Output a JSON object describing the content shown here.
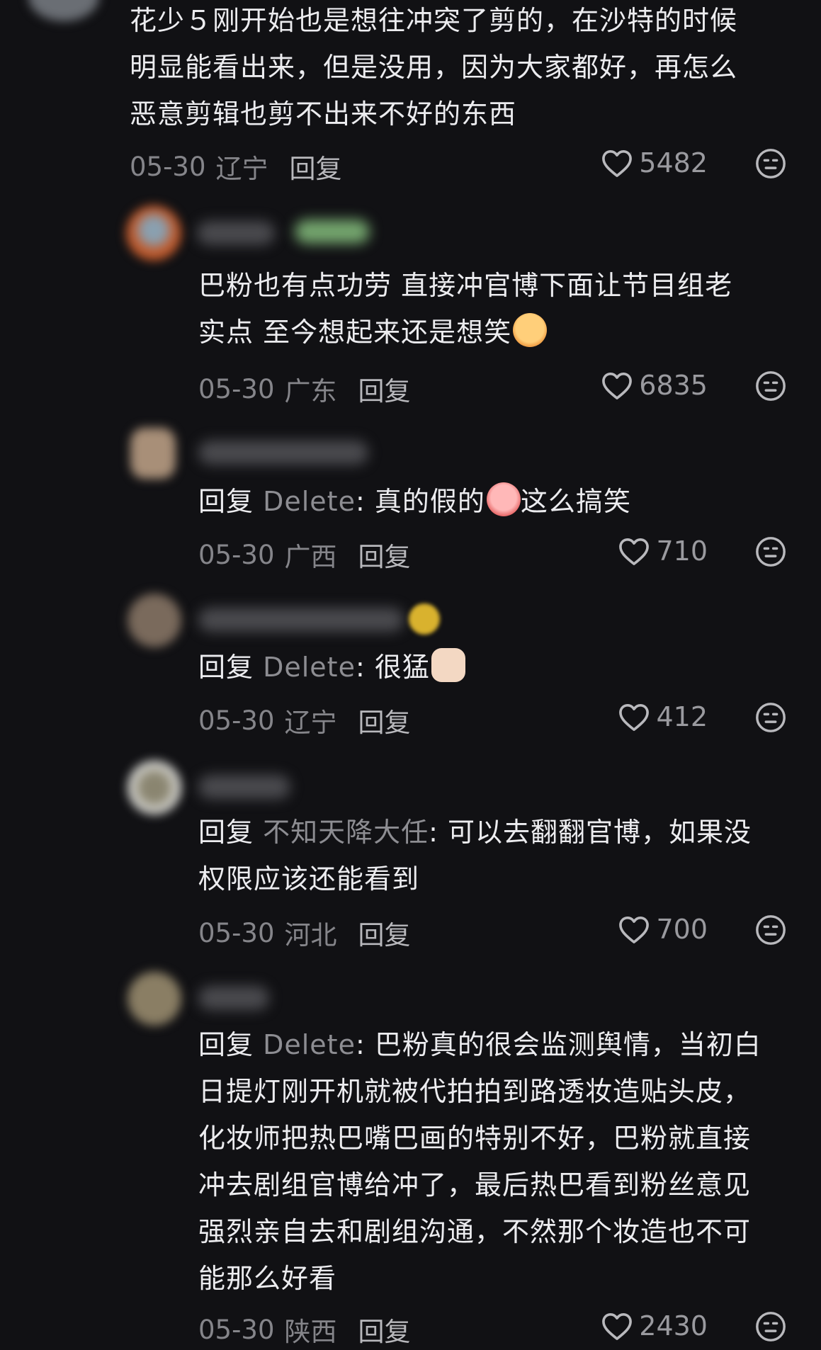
{
  "comments": [
    {
      "text": "花少５刚开始也是想往冲突了剪的，在沙特的时候明显能看出来，但是没用，因为大家都好，再怎么恶意剪辑也剪不出来不好的东西",
      "lines": [
        "花少５刚开始也是想往冲突了剪的，在沙特的时候",
        "明显能看出来，但是没用，因为大家都好，再怎么",
        "恶意剪辑也剪不出来不好的东西"
      ],
      "date": "05-30",
      "location": "辽宁",
      "reply_label": "回复",
      "likes": "5482"
    },
    {
      "lines": [
        "巴粉也有点功劳  直接冲官博下面让节目组老",
        "实点  至今想起来还是想笑"
      ],
      "emoji": "laughing-crying-emoji",
      "date": "05-30",
      "location": "广东",
      "reply_label": "回复",
      "likes": "6835"
    },
    {
      "reply_prefix": "回复",
      "mention": "Delete",
      "body_before": ": 真的假的",
      "body_after": "这么搞笑",
      "emoji": "crying-laughing-emoji",
      "date": "05-30",
      "location": "广西",
      "reply_label": "回复",
      "likes": "710"
    },
    {
      "reply_prefix": "回复",
      "mention": "Delete",
      "body": ": 很猛",
      "emoji": "thumbs-up-emoji",
      "date": "05-30",
      "location": "辽宁",
      "reply_label": "回复",
      "likes": "412"
    },
    {
      "reply_prefix": "回复",
      "mention": "不知天降大任",
      "body_line1": ": 可以去翻翻官博，如果没",
      "body_line2": "权限应该还能看到",
      "date": "05-30",
      "location": "河北",
      "reply_label": "回复",
      "likes": "700"
    },
    {
      "reply_prefix": "回复",
      "mention": "Delete",
      "body_line1": ": 巴粉真的很会监测舆情，当初白",
      "body_lines": [
        "日提灯刚开机就被代拍拍到路透妆造贴头皮，",
        "化妆师把热巴嘴巴画的特别不好，巴粉就直接",
        "冲去剧组官博给冲了，最后热巴看到粉丝意见",
        "强烈亲自去和剧组沟通，不然那个妆造也不可",
        "能那么好看"
      ],
      "date": "05-30",
      "location": "陕西",
      "reply_label": "回复",
      "likes": "2430"
    }
  ],
  "icons": {
    "like": "heart-outline-icon",
    "react": "neutral-face-icon"
  },
  "colors": {
    "background": "#111114",
    "text": "#ececef",
    "meta": "#85858a"
  }
}
